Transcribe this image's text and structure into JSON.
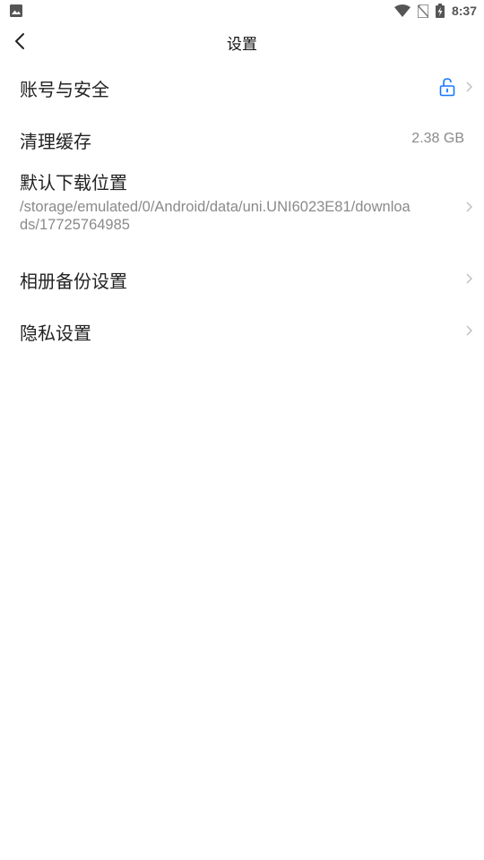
{
  "status_bar": {
    "time": "8:37",
    "left_icon": "image-notification-icon",
    "right_icons": [
      "wifi-icon",
      "no-sim-icon",
      "battery-charging-icon"
    ]
  },
  "header": {
    "title": "设置",
    "back_icon": "back-arrow-icon"
  },
  "settings": {
    "account": {
      "label": "账号与安全",
      "icon": "lock-icon"
    },
    "cache": {
      "label": "清理缓存",
      "value": "2.38 GB"
    },
    "download": {
      "label": "默认下载位置",
      "path": "/storage/emulated/0/Android/data/uni.UNI6023E81/downloads/17725764985"
    },
    "album_backup": {
      "label": "相册备份设置"
    },
    "privacy": {
      "label": "隐私设置"
    }
  },
  "colors": {
    "accent": "#1677ff",
    "secondary_text": "#8a8a8a",
    "primary_text": "#222222"
  }
}
